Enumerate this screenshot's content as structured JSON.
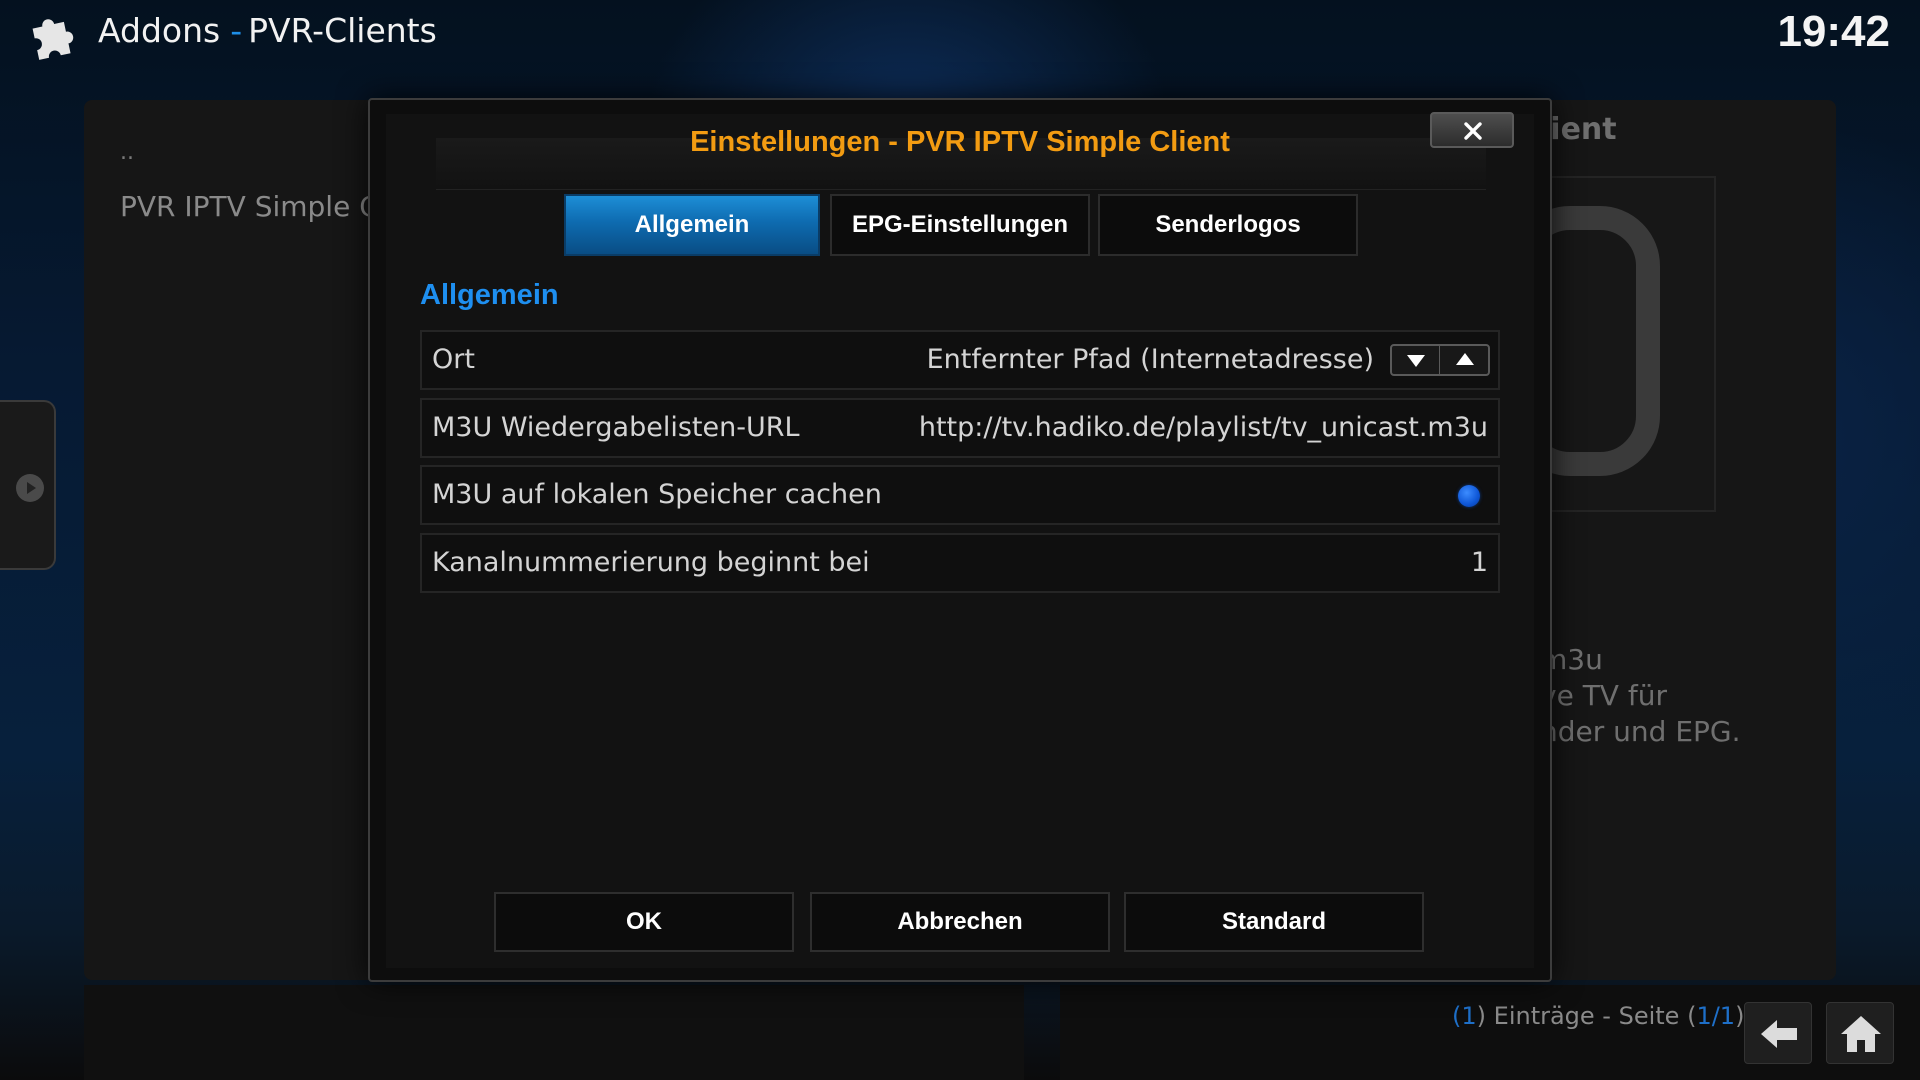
{
  "header": {
    "section": "Addons",
    "separator": "-",
    "page": "PVR-Clients",
    "clock": "19:42",
    "icon": "puzzle-icon"
  },
  "background": {
    "list_parent": "..",
    "list_item": "PVR IPTV Simple Client",
    "right_title": "lient",
    "right_description": [
      "m3u",
      "ve TV für",
      "nder und EPG."
    ],
    "page_info": {
      "open_paren": "(",
      "count": "1",
      "middle": ") Einträge - Seite (",
      "page": "1/1",
      "close_paren": ")"
    }
  },
  "dialog": {
    "title": "Einstellungen - PVR IPTV Simple Client",
    "tabs": [
      {
        "label": "Allgemein",
        "active": true
      },
      {
        "label": "EPG-Einstellungen",
        "active": false
      },
      {
        "label": "Senderlogos",
        "active": false
      }
    ],
    "section_heading": "Allgemein",
    "settings": [
      {
        "label": "Ort",
        "value": "Entfernter Pfad (Internetadresse)",
        "control": "spinner"
      },
      {
        "label": "M3U Wiedergabelisten-URL",
        "value": "http://tv.hadiko.de/playlist/tv_unicast.m3u",
        "control": "text"
      },
      {
        "label": "M3U auf lokalen Speicher cachen",
        "value": true,
        "control": "radio"
      },
      {
        "label": "Kanalnummerierung beginnt bei",
        "value": "1",
        "control": "number"
      }
    ],
    "buttons": {
      "ok": "OK",
      "cancel": "Abbrechen",
      "default": "Standard"
    }
  },
  "colors": {
    "accent_blue": "#1e8ff0",
    "title_orange": "#f39c12",
    "radio_on": "#0e56d6"
  }
}
